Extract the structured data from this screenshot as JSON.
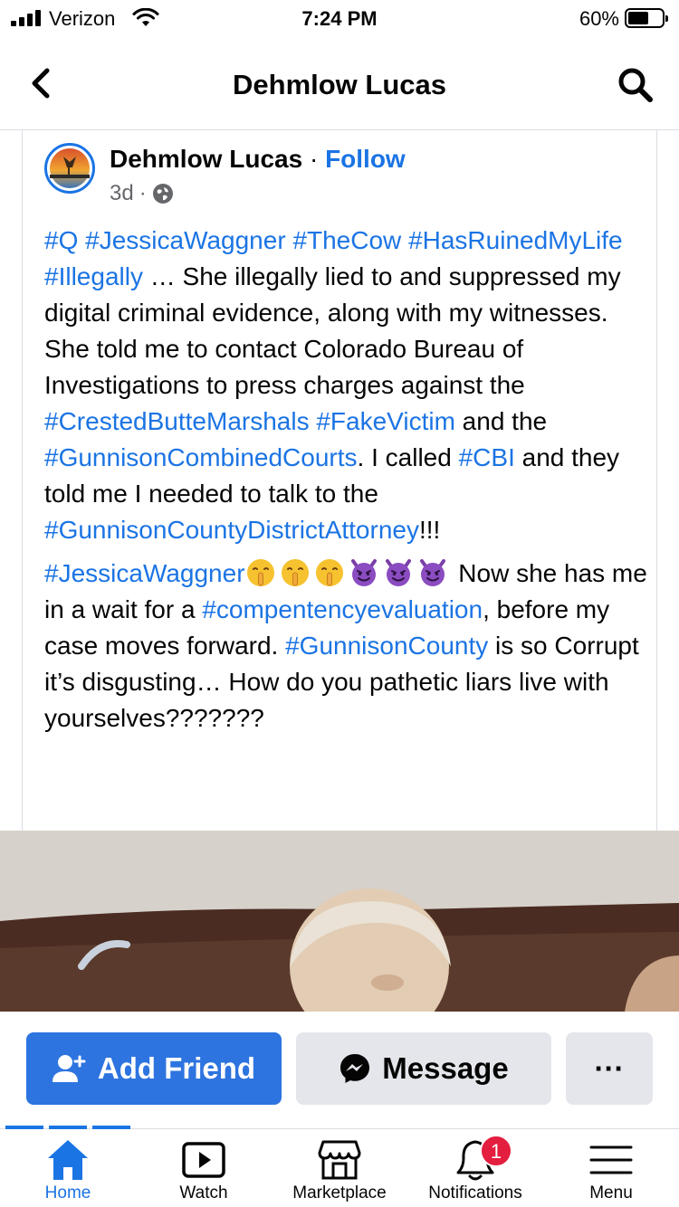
{
  "status_bar": {
    "carrier": "Verizon",
    "time": "7:24 PM",
    "battery_percent": "60%",
    "battery_level": 0.6
  },
  "header": {
    "title": "Dehmlow Lucas",
    "back_icon": "chevron-left-icon",
    "search_icon": "search-icon"
  },
  "post": {
    "author": "Dehmlow Lucas",
    "separator": " · ",
    "follow_label": "Follow",
    "time": "3d",
    "meta_separator": "·",
    "privacy_icon": "globe-icon",
    "paragraph1": [
      {
        "text": "#Q",
        "hashtag": true
      },
      {
        "text": " ",
        "hashtag": false
      },
      {
        "text": "#JessicaWaggner",
        "hashtag": true
      },
      {
        "text": " ",
        "hashtag": false
      },
      {
        "text": "#TheCow",
        "hashtag": true
      },
      {
        "text": " ",
        "hashtag": false
      },
      {
        "text": "#HasRuinedMyLife",
        "hashtag": true
      },
      {
        "text": " ",
        "hashtag": false
      },
      {
        "text": "#Illegally",
        "hashtag": true
      },
      {
        "text": " … She illegally lied to and suppressed my digital criminal evidence, along with my witnesses. She told me to contact Colorado Bureau of Investigations to press charges against the ",
        "hashtag": false
      },
      {
        "text": "#CrestedButteMarshals",
        "hashtag": true
      },
      {
        "text": " ",
        "hashtag": false
      },
      {
        "text": "#FakeVictim",
        "hashtag": true
      },
      {
        "text": " and the ",
        "hashtag": false
      },
      {
        "text": "#GunnisonCombinedCourts",
        "hashtag": true
      },
      {
        "text": ". I called ",
        "hashtag": false
      },
      {
        "text": "#CBI",
        "hashtag": true
      },
      {
        "text": " and they told me I needed to talk to the ",
        "hashtag": false
      },
      {
        "text": "#GunnisonCountyDistrictAttorney",
        "hashtag": true
      },
      {
        "text": "!!!",
        "hashtag": false
      }
    ],
    "paragraph2": [
      {
        "text": "#JessicaWaggner",
        "hashtag": true
      },
      {
        "emoji": "shushing-face-icon"
      },
      {
        "emoji": "shushing-face-icon"
      },
      {
        "emoji": "shushing-face-icon"
      },
      {
        "emoji": "smiling-imp-icon"
      },
      {
        "emoji": "smiling-imp-icon"
      },
      {
        "emoji": "smiling-imp-icon"
      },
      {
        "text": " Now she has me in a wait for a ",
        "hashtag": false
      },
      {
        "text": "#compentencyevaluation",
        "hashtag": true
      },
      {
        "text": ", before my case moves forward. ",
        "hashtag": false
      },
      {
        "text": "#GunnisonCounty",
        "hashtag": true
      },
      {
        "text": " is so Corrupt it’s disgusting… How do you pathetic liars live with yourselves???????",
        "hashtag": false
      }
    ]
  },
  "actions": {
    "add_friend_label": "Add Friend",
    "message_label": "Message",
    "more_label": "···"
  },
  "tabs": [
    {
      "label": "Home",
      "icon": "home-icon",
      "active": true
    },
    {
      "label": "Watch",
      "icon": "watch-icon",
      "active": false
    },
    {
      "label": "Marketplace",
      "icon": "marketplace-icon",
      "active": false
    },
    {
      "label": "Notifications",
      "icon": "bell-icon",
      "active": false,
      "badge": "1"
    },
    {
      "label": "Menu",
      "icon": "menu-icon",
      "active": false
    }
  ],
  "colors": {
    "accent": "#1b74e4",
    "add_friend_bg": "#2d74e0",
    "secondary_button_bg": "#e4e6eb",
    "badge": "#e41e3f",
    "meta_text": "#65676b"
  }
}
